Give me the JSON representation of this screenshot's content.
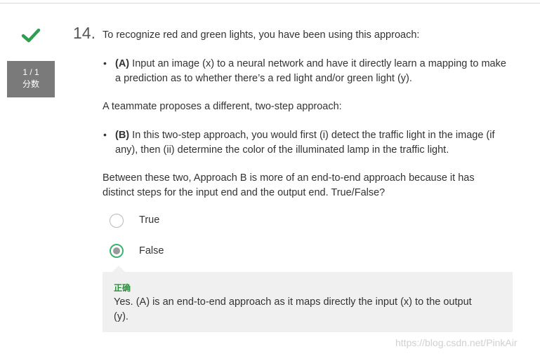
{
  "question": {
    "number": "14.",
    "prompt": "To recognize red and green lights, you have been using this approach:",
    "approach_a": {
      "label": "(A)",
      "text_line1": "Input an image (x) to a neural network and have it directly learn a mapping to make",
      "text_line2": "a prediction as to whether there’s a red light and/or green light (y)."
    },
    "teammate": "A teammate proposes a different, two-step approach:",
    "approach_b": {
      "label": "(B)",
      "text_line1": "In this two-step approach, you would first (i) detect the traffic light in the image (if",
      "text_line2": "any), then (ii) determine the color of the illuminated lamp in the traffic light."
    },
    "statement_line1": "Between these two, Approach B is more of an end-to-end approach because it has",
    "statement_line2": "distinct steps for the input end and the output end. True/False?"
  },
  "score": {
    "value": "1 / 1",
    "unit": "分数"
  },
  "options": [
    {
      "label": "True",
      "selected": false
    },
    {
      "label": "False",
      "selected": true
    }
  ],
  "feedback": {
    "title": "正确",
    "line1": "Yes. (A) is an end-to-end approach as it maps directly the input (x) to the output",
    "line2": "(y)."
  },
  "watermark": "https://blog.csdn.net/PinkAir",
  "colors": {
    "correct_green": "#2e8b3e",
    "radio_border_selected": "#3cb371",
    "score_bg": "#7a7a7a",
    "feedback_bg": "#f0f0f0"
  },
  "icons": {
    "status": "checkmark-icon",
    "bullet": "bullet-icon"
  }
}
